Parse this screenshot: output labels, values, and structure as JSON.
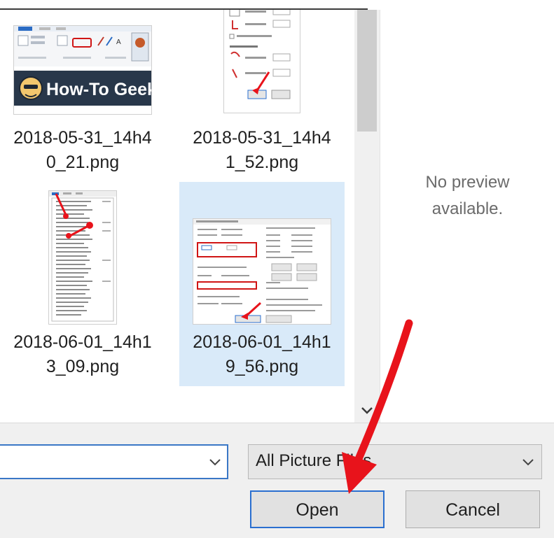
{
  "files": [
    {
      "name": "2018-05-31_14h4\n0_21.png",
      "selected": false,
      "thumb_text": "How-To Geek"
    },
    {
      "name": "2018-05-31_14h4\n1_52.png",
      "selected": false
    },
    {
      "name": "2018-06-01_14h1\n3_09.png",
      "selected": false
    },
    {
      "name": "2018-06-01_14h1\n9_56.png",
      "selected": true
    }
  ],
  "preview": {
    "message": "No preview\navailable."
  },
  "footer": {
    "filename_value": "",
    "filetype_selected": "All Picture Files",
    "open_label": "Open",
    "cancel_label": "Cancel"
  },
  "colors": {
    "selection": "#d9eaf9",
    "focus_border": "#3a77c6",
    "annotation_arrow": "#e8131b",
    "htg_banner": "#28374a"
  }
}
